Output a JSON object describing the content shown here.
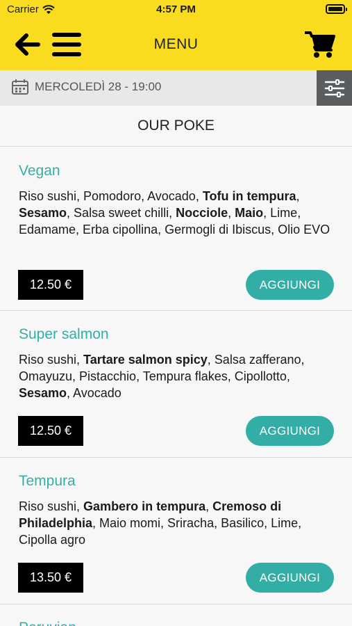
{
  "status_bar": {
    "carrier": "Carrier",
    "time": "4:57 PM",
    "wifi_icon": "wifi-icon",
    "battery_icon": "battery-icon"
  },
  "header": {
    "title": "MENU",
    "back_icon": "back-arrow-icon",
    "menu_icon": "hamburger-icon",
    "cart_icon": "cart-icon"
  },
  "date_bar": {
    "date": "MERCOLEDÌ 28 - 19:00",
    "calendar_icon": "calendar-icon",
    "filter_icon": "filter-sliders-icon"
  },
  "section": {
    "title": "OUR POKE"
  },
  "colors": {
    "header": "#f9dc1f",
    "accent": "#35aea8",
    "button": "#33aea6",
    "price_bg": "#000000",
    "filter_bg": "#5a5d60"
  },
  "items": [
    {
      "name": "Vegan",
      "description": [
        {
          "text": "Riso sushi, Pomodoro, Avocado, ",
          "bold": false
        },
        {
          "text": "Tofu in tempura",
          "bold": true
        },
        {
          "text": ", ",
          "bold": false
        },
        {
          "text": "Sesamo",
          "bold": true
        },
        {
          "text": ", Salsa sweet chilli, ",
          "bold": false
        },
        {
          "text": "Nocciole",
          "bold": true
        },
        {
          "text": ", ",
          "bold": false
        },
        {
          "text": "Maio",
          "bold": true
        },
        {
          "text": ", Lime, Edamame, Erba cipollina, Germogli di Ibiscus, Olio EVO",
          "bold": false
        }
      ],
      "price": "12.50 €",
      "add_label": "AGGIUNGI"
    },
    {
      "name": "Super salmon",
      "description": [
        {
          "text": "Riso sushi, ",
          "bold": false
        },
        {
          "text": "Tartare salmon spicy",
          "bold": true
        },
        {
          "text": ", Salsa zafferano, Omayuzu, Pistacchio, Tempura flakes, Cipollotto, ",
          "bold": false
        },
        {
          "text": "Sesamo",
          "bold": true
        },
        {
          "text": ", Avocado",
          "bold": false
        }
      ],
      "price": "12.50 €",
      "add_label": "AGGIUNGI"
    },
    {
      "name": "Tempura",
      "description": [
        {
          "text": "Riso sushi, ",
          "bold": false
        },
        {
          "text": "Gambero in tempura",
          "bold": true
        },
        {
          "text": ", ",
          "bold": false
        },
        {
          "text": "Cremoso di Philadelphia",
          "bold": true
        },
        {
          "text": ", Maio momi, Sriracha, Basilico, Lime, Cipolla agro",
          "bold": false
        }
      ],
      "price": "13.50 €",
      "add_label": "AGGIUNGI"
    },
    {
      "name": "Peruvian",
      "description": [],
      "price": "",
      "add_label": ""
    }
  ]
}
